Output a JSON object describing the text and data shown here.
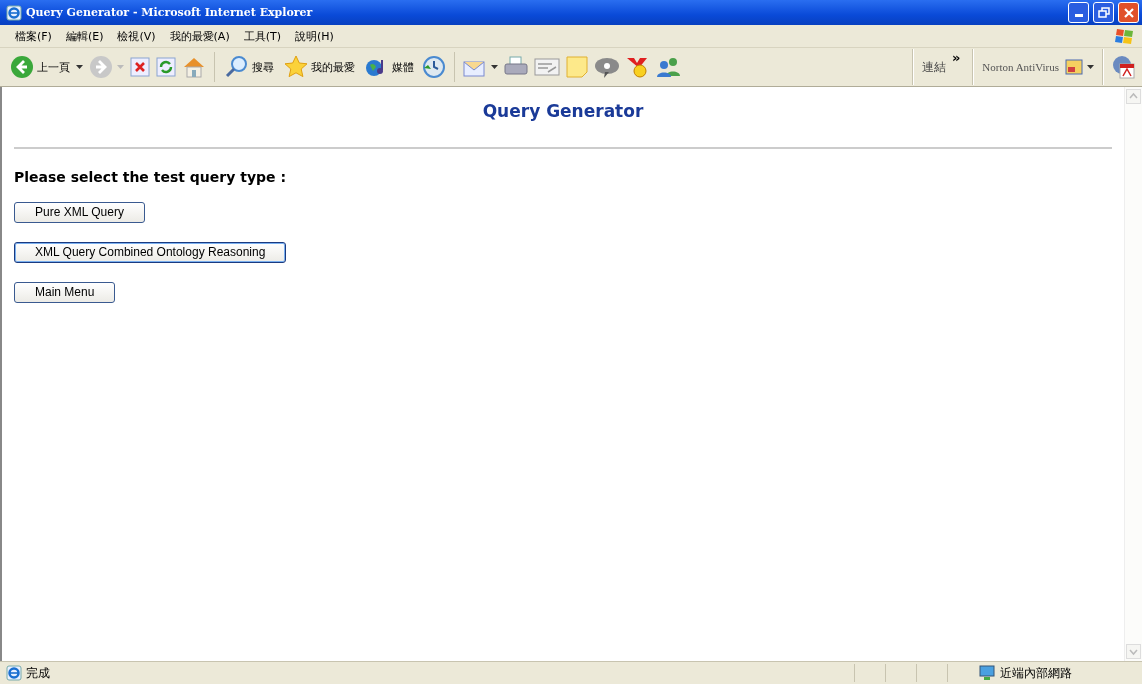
{
  "window": {
    "title": "Query Generator - Microsoft Internet Explorer"
  },
  "menu": [
    "檔案(F)",
    "編輯(E)",
    "檢視(V)",
    "我的最愛(A)",
    "工具(T)",
    "說明(H)"
  ],
  "toolbar": {
    "back": "上一頁",
    "search": "搜尋",
    "favorites": "我的最愛",
    "media": "媒體"
  },
  "links": {
    "label": "連結",
    "more": "»",
    "norton": "Norton AntiVirus"
  },
  "page": {
    "title": "Query Generator",
    "prompt": "Please select the test query type :",
    "buttons": [
      {
        "label": "Pure XML Query",
        "selected": false
      },
      {
        "label": "XML Query Combined Ontology Reasoning",
        "selected": true
      },
      {
        "label": "Main Menu",
        "selected": false
      }
    ]
  },
  "status_bar": {
    "text": "完成",
    "zone": "近端內部網路"
  }
}
